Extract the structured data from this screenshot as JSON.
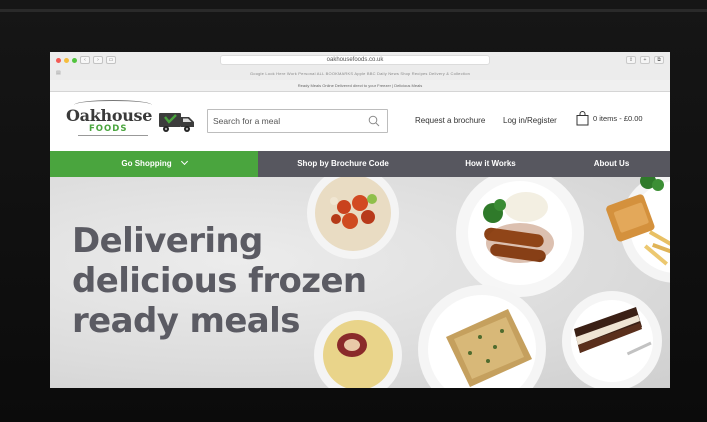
{
  "browser": {
    "url": "oakhousefoods.co.uk",
    "nav_back": "‹",
    "nav_forward": "›",
    "nav_sidebar": "▭",
    "right_buttons": [
      "⇪",
      "+",
      "⧉"
    ],
    "bookmarks": "Google   Look Here   Work   Personal   ALL BOOKMARKS   Apple   BBC   Daily   News   Shop   Recipes   Delivery & Collection",
    "announcement": "Ready Meals Online   Delivered direct to your Freezer   |   Delicious Meals",
    "sidebar_glyph": "▤"
  },
  "header": {
    "logo_word": "Oakhouse",
    "logo_sub": "FOODS",
    "search_placeholder": "Search for a meal",
    "request_brochure": "Request a brochure",
    "login": "Log in/Register",
    "cart": "0 items - £0.00"
  },
  "nav": {
    "shop": "Go Shopping",
    "brochure": "Shop by Brochure Code",
    "how": "How it Works",
    "about": "About Us"
  },
  "hero": {
    "line1": "Delivering",
    "line2": "delicious frozen",
    "line3": "ready meals"
  },
  "colors": {
    "brand_green": "#4aa53e",
    "nav_grey": "#57575f",
    "hero_text": "#5b5b63"
  }
}
